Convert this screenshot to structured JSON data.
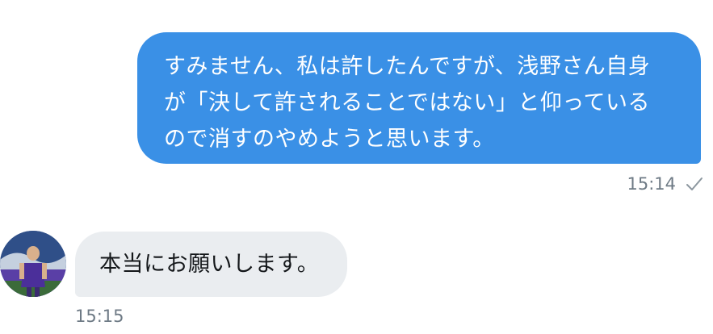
{
  "conversation": {
    "outgoing": {
      "lines": [
        "すみません、私は許したんですが、浅野さん自身",
        "が「決して許されることではない」と仰っている",
        "ので消すのやめようと思います。"
      ],
      "time": "15:14",
      "status_icon": "checkmark-icon",
      "bubble_color": "#3a90e6"
    },
    "incoming": {
      "text": "本当にお願いします。",
      "time": "15:15",
      "bubble_color": "#eaedf0"
    }
  }
}
